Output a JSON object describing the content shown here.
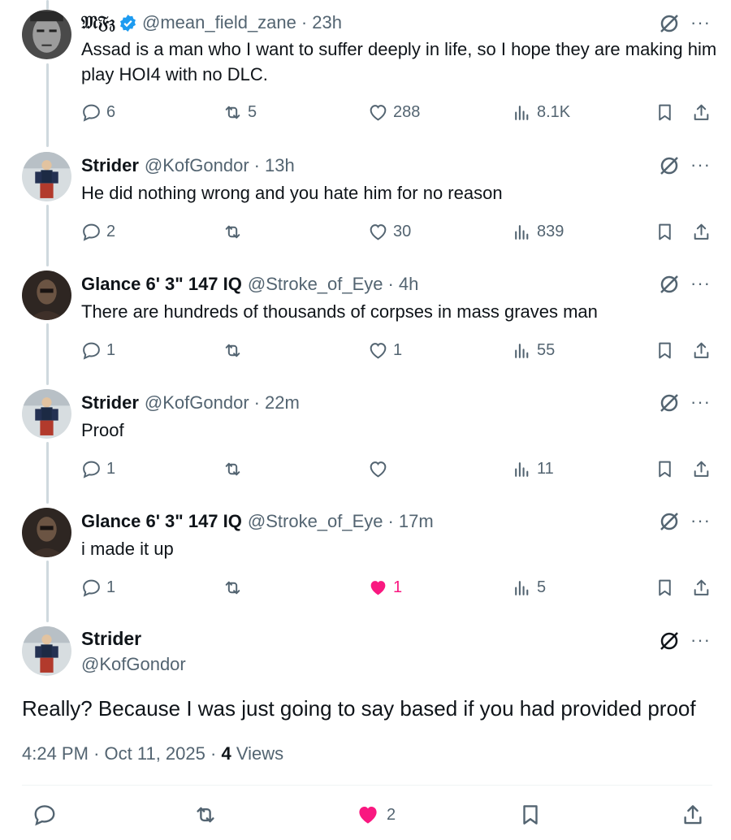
{
  "colors": {
    "text": "#0f1419",
    "secondary": "#536471",
    "like": "#f91880",
    "verified": "#1d9bf0"
  },
  "replies": [
    {
      "name": "𝔐𝔉𝔷",
      "handle": "@mean_field_zane",
      "time": "23h",
      "verified": true,
      "text": "Assad is a man who I want to suffer deeply in life, so I hope they are making him play HOI4 with no DLC.",
      "reply_count": "6",
      "repost_count": "5",
      "like_count": "288",
      "views": "8.1K",
      "liked": false
    },
    {
      "name": "Strider",
      "handle": "@KofGondor",
      "time": "13h",
      "verified": false,
      "text": "He did nothing wrong and you hate him for no reason",
      "reply_count": "2",
      "repost_count": "",
      "like_count": "30",
      "views": "839",
      "liked": false
    },
    {
      "name": "Glance 6' 3\" 147 IQ",
      "handle": "@Stroke_of_Eye",
      "time": "4h",
      "verified": false,
      "text": "There are hundreds of thousands of corpses in mass graves man",
      "reply_count": "1",
      "repost_count": "",
      "like_count": "1",
      "views": "55",
      "liked": false
    },
    {
      "name": "Strider",
      "handle": "@KofGondor",
      "time": "22m",
      "verified": false,
      "text": "Proof",
      "reply_count": "1",
      "repost_count": "",
      "like_count": "",
      "views": "11",
      "liked": false
    },
    {
      "name": "Glance 6' 3\" 147 IQ",
      "handle": "@Stroke_of_Eye",
      "time": "17m",
      "verified": false,
      "text": "i made it up",
      "reply_count": "1",
      "repost_count": "",
      "like_count": "1",
      "views": "5",
      "liked": true
    }
  ],
  "main": {
    "name": "Strider",
    "handle": "@KofGondor",
    "text": "Really? Because I was just going to say based if you had provided proof",
    "time": "4:24 PM",
    "date": "Oct 11, 2025",
    "views_count": "4",
    "views_label": "Views",
    "like_count": "2",
    "liked": true
  },
  "separator": "·"
}
